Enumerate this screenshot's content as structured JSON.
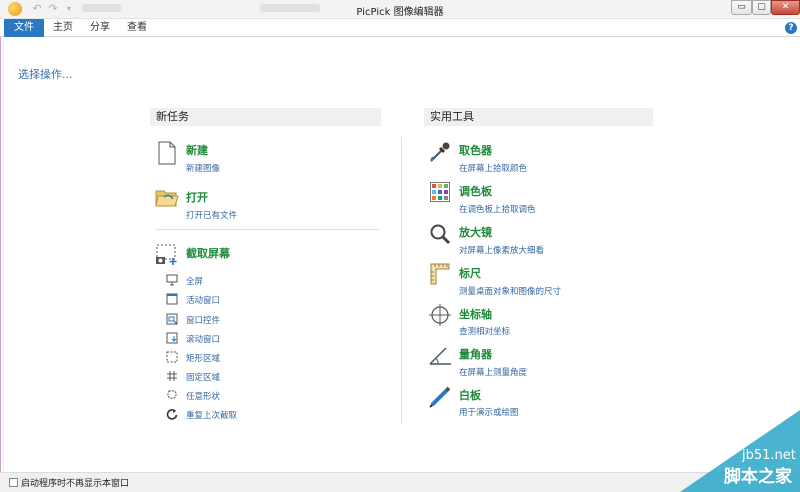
{
  "window": {
    "title": "PicPick 图像编辑器",
    "min_label": "▭",
    "max_label": "▢",
    "close_label": "✕"
  },
  "quick_access": {
    "undo": "↶",
    "redo": "↷",
    "more": "▾"
  },
  "menu": {
    "items": [
      {
        "label": "文件",
        "active": true
      },
      {
        "label": "主页"
      },
      {
        "label": "分享"
      },
      {
        "label": "查看"
      }
    ],
    "help": "?"
  },
  "main": {
    "select_operation": "选择操作...",
    "new_task": {
      "header": "新任务",
      "items": [
        {
          "title": "新建",
          "subtitle": "新建图像"
        },
        {
          "title": "打开",
          "subtitle": "打开已有文件"
        }
      ],
      "capture": {
        "title": "截取屏幕",
        "items": [
          "全屏",
          "活动窗口",
          "窗口控件",
          "滚动窗口",
          "矩形区域",
          "固定区域",
          "任意形状",
          "重复上次截取"
        ]
      }
    },
    "tools": {
      "header": "实用工具",
      "items": [
        {
          "title": "取色器",
          "subtitle": "在屏幕上拾取颜色"
        },
        {
          "title": "调色板",
          "subtitle": "在调色板上拾取调色"
        },
        {
          "title": "放大镜",
          "subtitle": "对屏幕上像素放大细看"
        },
        {
          "title": "标尺",
          "subtitle": "测量桌面对象和图像的尺寸"
        },
        {
          "title": "坐标轴",
          "subtitle": "查测相对坐标"
        },
        {
          "title": "量角器",
          "subtitle": "在屏幕上测量角度"
        },
        {
          "title": "白板",
          "subtitle": "用于演示或绘图"
        }
      ]
    }
  },
  "footer": {
    "checkbox_label": "启动程序时不再显示本窗口"
  },
  "watermark": {
    "line1": "jb51.net",
    "line2": "脚本之家"
  },
  "colors": {
    "accent": "#2b78c2",
    "title_green": "#1f8a3a",
    "link_blue": "#3567a0"
  }
}
